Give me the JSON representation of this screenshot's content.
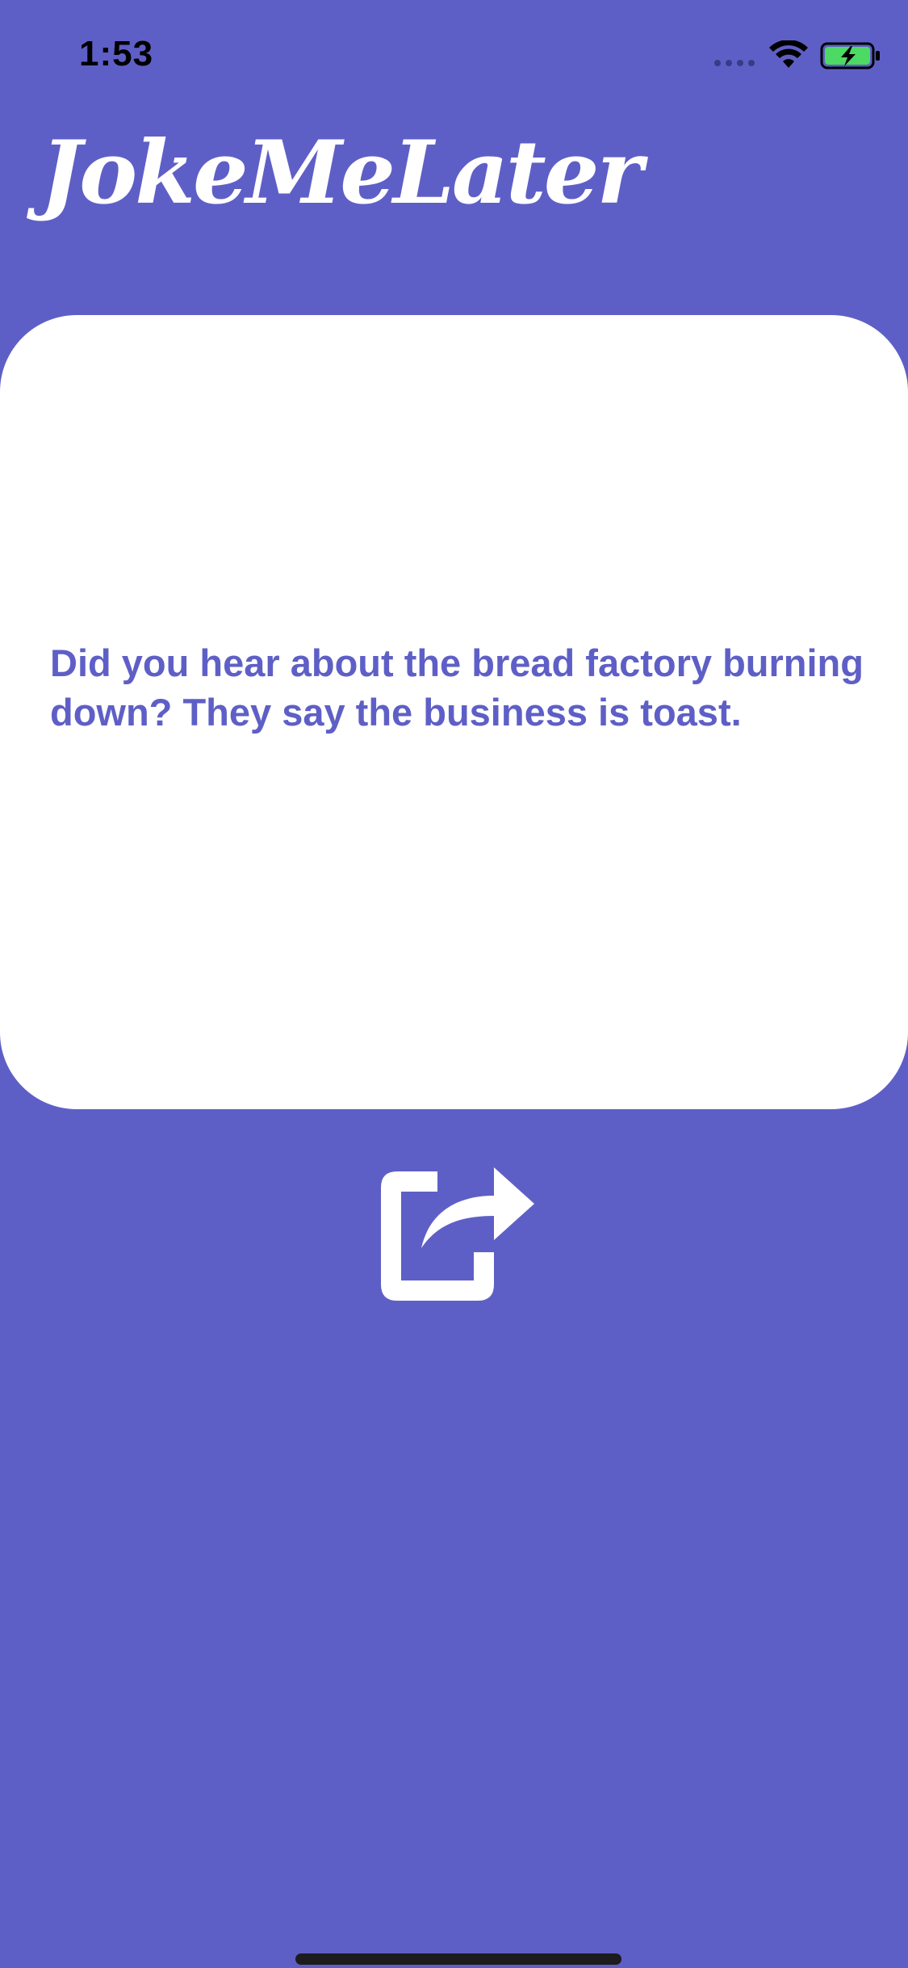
{
  "status_bar": {
    "time": "1:53",
    "icons": [
      "signal-dots-icon",
      "wifi-icon",
      "battery-charging-icon"
    ]
  },
  "app": {
    "title": "JokeMeLater"
  },
  "joke": {
    "text": "Did you hear about the bread factory burning down? They say the business is toast."
  },
  "actions": {
    "share_icon": "share-icon"
  },
  "colors": {
    "background": "#5e5fc6",
    "card": "#ffffff",
    "joke_text": "#5e5fc6",
    "battery_fill": "#4cd964"
  }
}
